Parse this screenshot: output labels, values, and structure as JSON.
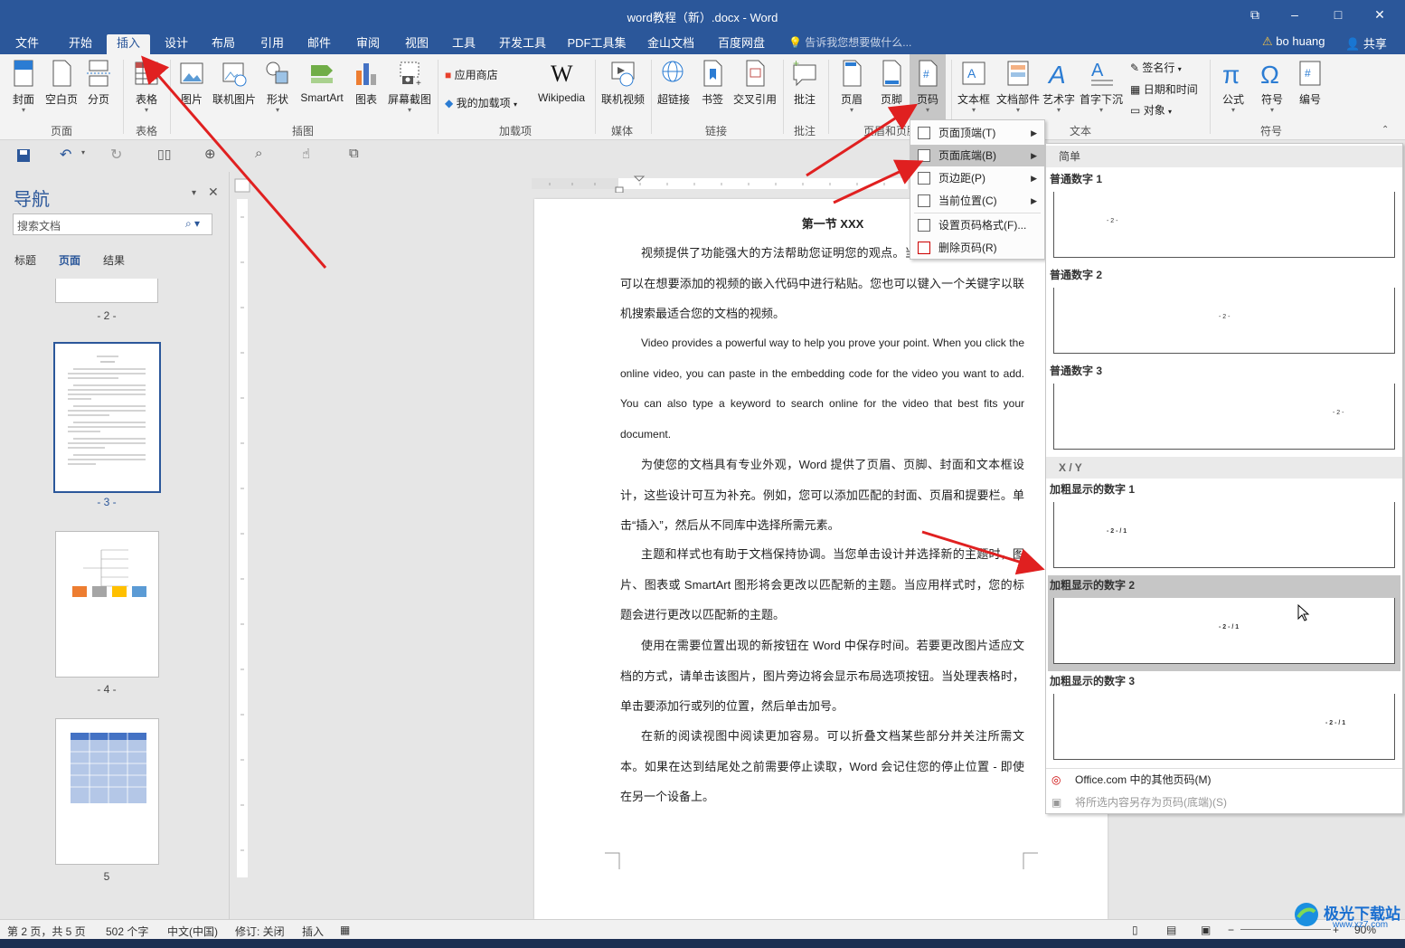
{
  "window": {
    "title": "word教程（新）.docx - Word",
    "min": "–",
    "restore": "⧉",
    "max": "□",
    "close": "✕"
  },
  "menu_tabs": [
    "文件",
    "开始",
    "插入",
    "设计",
    "布局",
    "引用",
    "邮件",
    "审阅",
    "视图",
    "工具",
    "开发工具",
    "PDF工具集",
    "金山文档",
    "百度网盘"
  ],
  "active_tab": "插入",
  "tell_me": "告诉我您想要做什么...",
  "user": "bo huang",
  "share": "共享",
  "ribbon": {
    "buttons": [
      "封面",
      "空白页",
      "分页",
      "表格",
      "图片",
      "联机图片",
      "形状",
      "SmartArt",
      "图表",
      "屏幕截图",
      "Wikipedia",
      "联机视频",
      "超链接",
      "书签",
      "交叉引用",
      "批注",
      "页眉",
      "页脚",
      "页码",
      "文本框",
      "文档部件",
      "艺术字",
      "首字下沉",
      "公式",
      "符号",
      "编号"
    ],
    "small_buttons": [
      "应用商店",
      "我的加载项",
      "签名行",
      "日期和时间",
      "对象"
    ],
    "groups": [
      "页面",
      "表格",
      "插图",
      "加载项",
      "媒体",
      "链接",
      "批注",
      "页眉和页脚",
      "文本",
      "符号"
    ]
  },
  "nav": {
    "title": "导航",
    "search_placeholder": "搜索文档",
    "tabs": [
      "标题",
      "页面",
      "结果"
    ],
    "active_tab": "页面",
    "page_labels": [
      "- 2 -",
      "- 3 -",
      "- 4 -",
      "5"
    ]
  },
  "document": {
    "heading": "第一节  XXX",
    "paragraphs": [
      "视频提供了功能强大的方法帮助您证明您的观点。当您单击联机视频时，可以在想要添加的视频的嵌入代码中进行粘贴。您也可以键入一个关键字以联机搜索最适合您的文档的视频。",
      "Video provides a powerful way to help you prove your point. When you click the online video, you can paste in the embedding code for the video you want to add. You can also type a keyword to search online for the video that best fits your document.",
      "为使您的文档具有专业外观，Word 提供了页眉、页脚、封面和文本框设计，这些设计可互为补充。例如，您可以添加匹配的封面、页眉和提要栏。单击“插入”，然后从不同库中选择所需元素。",
      "主题和样式也有助于文档保持协调。当您单击设计并选择新的主题时，图片、图表或 SmartArt 图形将会更改以匹配新的主题。当应用样式时，您的标题会进行更改以匹配新的主题。",
      "使用在需要位置出现的新按钮在 Word 中保存时间。若要更改图片适应文档的方式，请单击该图片，图片旁边将会显示布局选项按钮。当处理表格时，单击要添加行或列的位置，然后单击加号。",
      "在新的阅读视图中阅读更加容易。可以折叠文档某些部分并关注所需文本。如果在达到结尾处之前需要停止读取，Word 会记住您的停止位置 - 即使在另一个设备上。"
    ]
  },
  "page_number_menu": {
    "items": [
      "页面顶端(T)",
      "页面底端(B)",
      "页边距(P)",
      "当前位置(C)",
      "设置页码格式(F)...",
      "删除页码(R)"
    ],
    "highlighted": "页面底端(B)"
  },
  "gallery": {
    "section1": "简单",
    "section2": "X / Y",
    "items": [
      {
        "label": "普通数字 1",
        "sample": "- 2 -"
      },
      {
        "label": "普通数字 2",
        "sample": "- 2 -"
      },
      {
        "label": "普通数字 3",
        "sample": "- 2 -"
      },
      {
        "label": "加粗显示的数字 1",
        "sample": "- 2 - / 1"
      },
      {
        "label": "加粗显示的数字 2",
        "sample": "- 2 - / 1"
      },
      {
        "label": "加粗显示的数字 3",
        "sample": "- 2 - / 1"
      }
    ],
    "highlighted": "加粗显示的数字 2",
    "footer": [
      "Office.com 中的其他页码(M)",
      "将所选内容另存为页码(底端)(S)"
    ]
  },
  "status": {
    "page": "第 2 页，共 5 页",
    "words": "502 个字",
    "lang": "中文(中国)",
    "track": "修订: 关闭",
    "mode": "插入",
    "zoom": "90%"
  },
  "watermark": {
    "brand": "极光下载站",
    "url": "www.xz7.com"
  },
  "colors": {
    "accent": "#2b579a",
    "arrow": "#e02020"
  }
}
